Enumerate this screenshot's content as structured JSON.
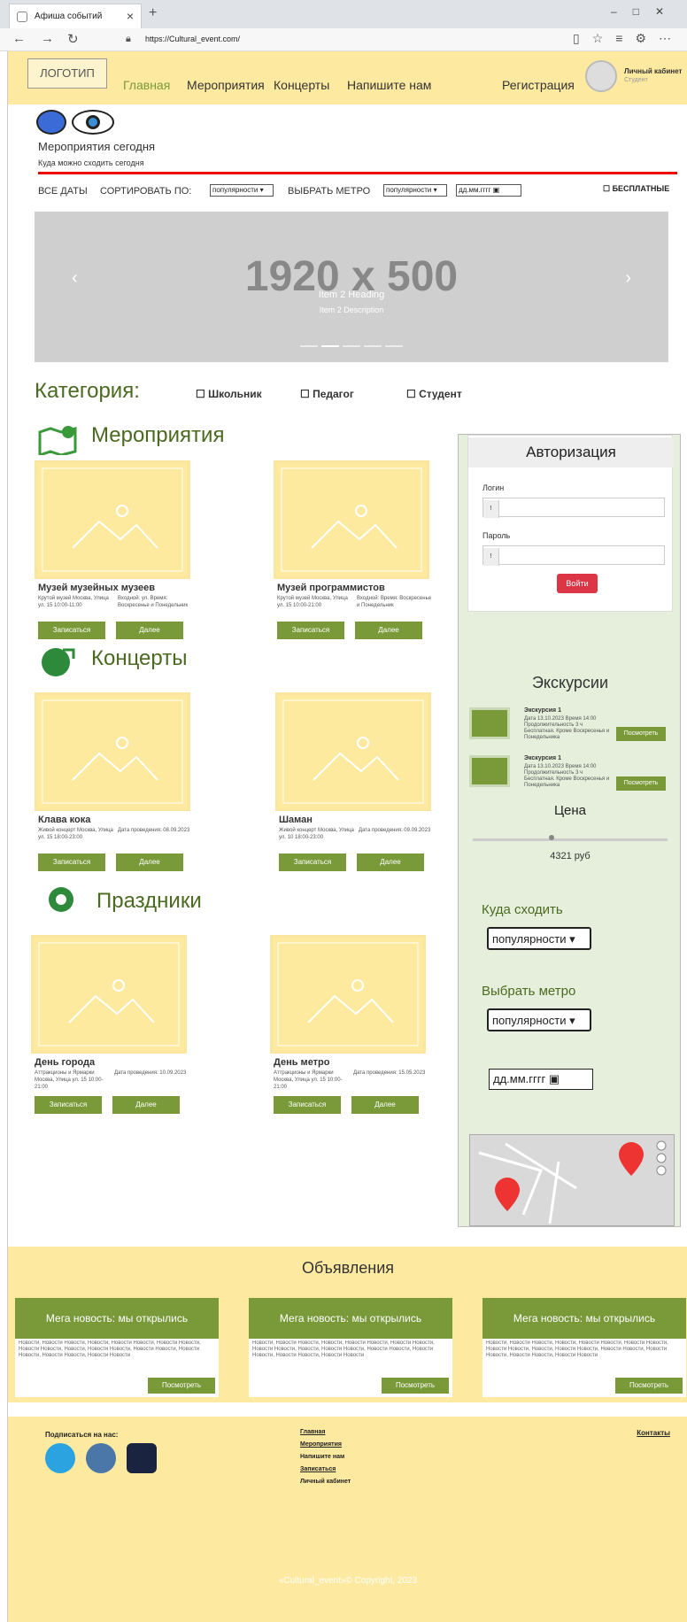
{
  "browser": {
    "tab_title": "Афиша событий",
    "url": "https://Cultural_event.com/"
  },
  "header": {
    "logo": "ЛОГОТИП",
    "nav": [
      "Главная",
      "Мероприятия",
      "Концерты",
      "Напишите нам"
    ],
    "register": "Регистрация",
    "cabinet": "Личный кабинет",
    "cabinet_sub": "Студент"
  },
  "hero": {
    "title": "Мероприятия сегодня",
    "subtitle": "Куда можно сходить сегодня"
  },
  "filters": {
    "all_dates": "ВСЕ ДАТЫ",
    "sort_label": "СОРТИРОВАТЬ ПО:",
    "sort_value": "популярности",
    "metro_label": "ВЫБРАТЬ МЕТРО",
    "metro_value": "популярности",
    "date_placeholder": "дд.мм.гггг",
    "free": "БЕСПЛАТНЫЕ"
  },
  "carousel": {
    "big": "1920 x 500",
    "heading": "Item 2 Heading",
    "description": "Item 2 Description",
    "active_slide": 2,
    "slide_count": 5
  },
  "category": {
    "label": "Категория:",
    "options": [
      "Школьник",
      "Педагог",
      "Студент"
    ]
  },
  "sections": {
    "events": {
      "title": "Мероприятия",
      "cards": [
        {
          "title": "Музей музейных музеев",
          "left": "Крутой музей Москва, Улица ул. 15 10:00-11:00",
          "right": "Входной: ул. Время: Воскресенье и Понедельник",
          "btn1": "Записаться",
          "btn2": "Далее"
        },
        {
          "title": "Музей программистов",
          "left": "Крутой музей Москва, Улица ул. 15 10:00-21:00",
          "right": "Входной: Время: Воскресенье и Понедельник",
          "btn1": "Записаться",
          "btn2": "Далее"
        }
      ]
    },
    "concerts": {
      "title": "Концерты",
      "cards": [
        {
          "title": "Клава кока",
          "left": "Живой концерт Москва, Улица ул. 15 18:00-23:00",
          "right": "Дата проведения: 08.09.2023",
          "btn1": "Записаться",
          "btn2": "Далее"
        },
        {
          "title": "Шаман",
          "left": "Живой концерт Москва, Улица ул. 10 18:00-23:00",
          "right": "Дата проведения: 09.09.2023",
          "btn1": "Записаться",
          "btn2": "Далее"
        }
      ]
    },
    "holidays": {
      "title": "Праздники",
      "cards": [
        {
          "title": "День города",
          "left": "Аттракционы и Ярмарки Москва, Улица ул. 15 10:00-21:00",
          "right": "Дата проведения: 10.09.2023",
          "btn1": "Записаться",
          "btn2": "Далее"
        },
        {
          "title": "День метро",
          "left": "Аттракционы и Ярмарки Москва, Улица ул. 15 10:00-21:00",
          "right": "Дата проведения: 15.05.2023",
          "btn1": "Записаться",
          "btn2": "Далее"
        }
      ]
    }
  },
  "sidebar": {
    "auth_title": "Авторизация",
    "login_label": "Логин",
    "password_label": "Пароль",
    "login_button": "Войти",
    "excursions_title": "Экскурсии",
    "excursions": [
      {
        "name": "Экскурсия 1",
        "desc": "Дата 13.10.2023 Время 14:00 Продолжительность 3 ч Бесплатная. Кроме Воскресенья и Понедельника",
        "btn": "Посмотреть"
      },
      {
        "name": "Экскурсия 1",
        "desc": "Дата 13.10.2023 Время 14:00 Продолжительность 3 ч Бесплатная. Кроме Воскресенья и Понедельника",
        "btn": "Посмотреть"
      }
    ],
    "price_title": "Цена",
    "price_value": "4321 руб",
    "where_title": "Куда сходить",
    "where_value": "популярности",
    "metro_title": "Выбрать метро",
    "metro_value": "популярности",
    "date_placeholder": "дд.мм.гггг"
  },
  "announcements": {
    "title": "Объявления",
    "items": [
      {
        "title": "Мега новость: мы открылись",
        "body": "Новости, Новости Новости, Новости, Новости Новости, Новости Новости, Новости Новости, Новости, Новости Новости, Новости Новости, Новости Новости, Новости Новости, Новости Новости",
        "btn": "Посмотреть"
      },
      {
        "title": "Мега новость: мы открылись",
        "body": "Новости, Новости Новости, Новости, Новости Новости, Новости Новости, Новости Новости, Новости, Новости Новости, Новости Новости, Новости Новости, Новости Новости, Новости Новости",
        "btn": "Посмотреть"
      },
      {
        "title": "Мега новость: мы открылись",
        "body": "Новости, Новости Новости, Новости, Новости Новости, Новости Новости, Новости Новости, Новости, Новости Новости, Новости Новости, Новости Новости, Новости Новости, Новости Новости",
        "btn": "Посмотреть"
      }
    ]
  },
  "footer": {
    "subscribe": "Подписаться на нас:",
    "links": [
      "Главная",
      "Мероприятия",
      "Напишите нам",
      "Записаться",
      "Личный кабинет"
    ],
    "contacts": "Контакты",
    "copyright": "«Cultural_event»© Copyright, 2023"
  },
  "colors": {
    "accent": "#7a9a3a",
    "header_bg": "#fdeaa0",
    "danger": "#dc3545"
  }
}
